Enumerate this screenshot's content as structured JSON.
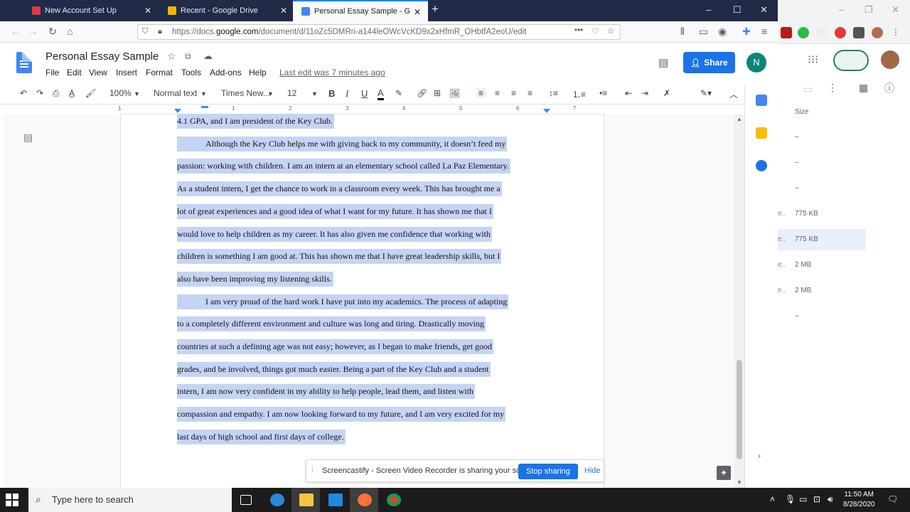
{
  "browser": {
    "tabs": [
      {
        "label": "New Account Set Up",
        "icon": "adobe-icon",
        "color": "#e03a3e"
      },
      {
        "label": "Recent - Google Drive",
        "icon": "drive-icon",
        "color": "#f4b400"
      },
      {
        "label": "Personal Essay Sample - Googl",
        "icon": "docs-icon",
        "color": "#4285f4",
        "active": true
      }
    ],
    "new_tab": "+",
    "url_prefix": "https://docs.",
    "url_domain": "google.com",
    "url_rest": "/document/d/11oZc5DMRri-a144leOWcVcKD9x2xHfmR_OHbtfA2eoU/edit"
  },
  "doc": {
    "title": "Personal Essay Sample",
    "menus": [
      "File",
      "Edit",
      "View",
      "Insert",
      "Format",
      "Tools",
      "Add-ons",
      "Help"
    ],
    "last_edit": "Last edit was 7 minutes ago",
    "share_label": "Share",
    "avatar_initial": "N"
  },
  "toolbar": {
    "zoom": "100%",
    "style": "Normal text",
    "font": "Times New...",
    "size": "12",
    "bold": "B",
    "italic": "I",
    "underline": "U",
    "text_color": "A"
  },
  "ruler": [
    "1",
    "1",
    "2",
    "3",
    "4",
    "5",
    "6",
    "7"
  ],
  "body_lines": [
    {
      "text": "4.1 GPA, and I am president of the Key Club.",
      "indent": false
    },
    {
      "text": "Although the Key Club helps me with giving back to my community, it doesn’t feed my",
      "indent": true
    },
    {
      "text": "passion: working with children. I am an intern at an elementary school called La Paz Elementary.",
      "indent": false
    },
    {
      "text": "As a student intern, I get the chance to work in a classroom every week. This has brought me a",
      "indent": false
    },
    {
      "text": "lot of great experiences and a good idea of what I want for my future. It has shown me that I",
      "indent": false
    },
    {
      "text": "would love to help children as my career. It has also given me confidence that working with",
      "indent": false
    },
    {
      "text": "children is something I am good at. This has shown me that I have great leadership skills, but I",
      "indent": false
    },
    {
      "text": "also have been improving my listening skills.",
      "indent": false
    },
    {
      "text": "I am very proud of the hard work I have put into my academics. The process of adapting",
      "indent": true
    },
    {
      "text": "to a completely different environment and culture was long and tiring. Drastically moving",
      "indent": false
    },
    {
      "text": "countries at such a defining age was not easy; however, as I began to make friends, get good",
      "indent": false
    },
    {
      "text": "grades, and be involved, things got much easier. Being a part of the Key Club and a student",
      "indent": false
    },
    {
      "text": "intern, I am now very confident in my ability to help people, lead them, and listen with",
      "indent": false
    },
    {
      "text": "compassion and empathy. I am now looking forward to my future, and I am very excited for my",
      "indent": false
    },
    {
      "text": "last days of high school and first days of college.",
      "indent": false
    }
  ],
  "notification": {
    "message": "Screencastify - Screen Video Recorder is sharing your screen.",
    "stop_label": "Stop sharing",
    "hide_label": "Hide"
  },
  "background_drive": {
    "size_header": "Size",
    "rows": [
      {
        "prefix": "",
        "size": "–"
      },
      {
        "prefix": "",
        "size": "–"
      },
      {
        "prefix": "",
        "size": "–"
      },
      {
        "prefix": "e..",
        "size": "775 KB"
      },
      {
        "prefix": "e..",
        "size": "775 KB",
        "selected": true
      },
      {
        "prefix": "e..",
        "size": "2 MB"
      },
      {
        "prefix": "e..",
        "size": "2 MB"
      },
      {
        "prefix": "",
        "size": "–"
      }
    ]
  },
  "taskbar": {
    "search_placeholder": "Type here to search",
    "time": "11:50 AM",
    "date": "8/28/2020"
  },
  "colors": {
    "accent": "#1a73e8",
    "selection": "#c5d4f4",
    "tabbar": "#1f2b47"
  }
}
